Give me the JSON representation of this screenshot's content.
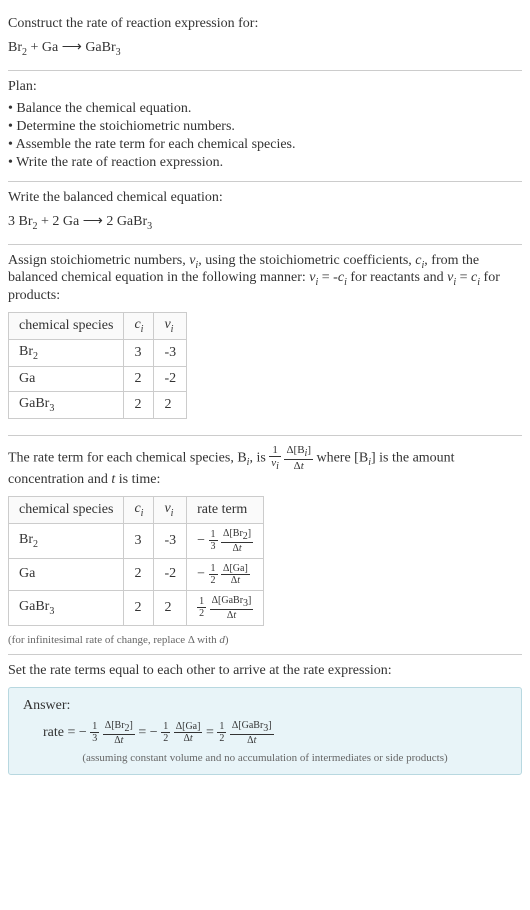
{
  "prompt": {
    "line1": "Construct the rate of reaction expression for:",
    "equation": "Br₂ + Ga ⟶ GaBr₃"
  },
  "plan": {
    "header": "Plan:",
    "items": [
      "• Balance the chemical equation.",
      "• Determine the stoichiometric numbers.",
      "• Assemble the rate term for each chemical species.",
      "• Write the rate of reaction expression."
    ]
  },
  "balanced": {
    "header": "Write the balanced chemical equation:",
    "equation": "3 Br₂ + 2 Ga ⟶ 2 GaBr₃"
  },
  "stoich": {
    "text1": "Assign stoichiometric numbers, νᵢ, using the stoichiometric coefficients, cᵢ, from the balanced chemical equation in the following manner: νᵢ = -cᵢ for reactants and νᵢ = cᵢ for products:",
    "table": {
      "headers": [
        "chemical species",
        "cᵢ",
        "νᵢ"
      ],
      "rows": [
        {
          "species": "Br₂",
          "c": "3",
          "v": "-3"
        },
        {
          "species": "Ga",
          "c": "2",
          "v": "-2"
        },
        {
          "species": "GaBr₃",
          "c": "2",
          "v": "2"
        }
      ]
    }
  },
  "rateterm": {
    "text_pre": "The rate term for each chemical species, Bᵢ, is ",
    "text_mid": " where [Bᵢ] is the amount concentration and t is time:",
    "table": {
      "headers": [
        "chemical species",
        "cᵢ",
        "νᵢ",
        "rate term"
      ],
      "rows": [
        {
          "species": "Br₂",
          "c": "3",
          "v": "-3",
          "sign": "−",
          "coef_top": "1",
          "coef_bot": "3",
          "delta_top": "Δ[Br₂]",
          "delta_bot": "Δt"
        },
        {
          "species": "Ga",
          "c": "2",
          "v": "-2",
          "sign": "−",
          "coef_top": "1",
          "coef_bot": "2",
          "delta_top": "Δ[Ga]",
          "delta_bot": "Δt"
        },
        {
          "species": "GaBr₃",
          "c": "2",
          "v": "2",
          "sign": "",
          "coef_top": "1",
          "coef_bot": "2",
          "delta_top": "Δ[GaBr₃]",
          "delta_bot": "Δt"
        }
      ]
    },
    "note": "(for infinitesimal rate of change, replace Δ with d)"
  },
  "final": {
    "header": "Set the rate terms equal to each other to arrive at the rate expression:"
  },
  "answer": {
    "label": "Answer:",
    "prefix": "rate = ",
    "terms": [
      {
        "sign": "−",
        "coef_top": "1",
        "coef_bot": "3",
        "delta_top": "Δ[Br₂]",
        "delta_bot": "Δt"
      },
      {
        "sign": "−",
        "coef_top": "1",
        "coef_bot": "2",
        "delta_top": "Δ[Ga]",
        "delta_bot": "Δt"
      },
      {
        "sign": "",
        "coef_top": "1",
        "coef_bot": "2",
        "delta_top": "Δ[GaBr₃]",
        "delta_bot": "Δt"
      }
    ],
    "note": "(assuming constant volume and no accumulation of intermediates or side products)"
  }
}
